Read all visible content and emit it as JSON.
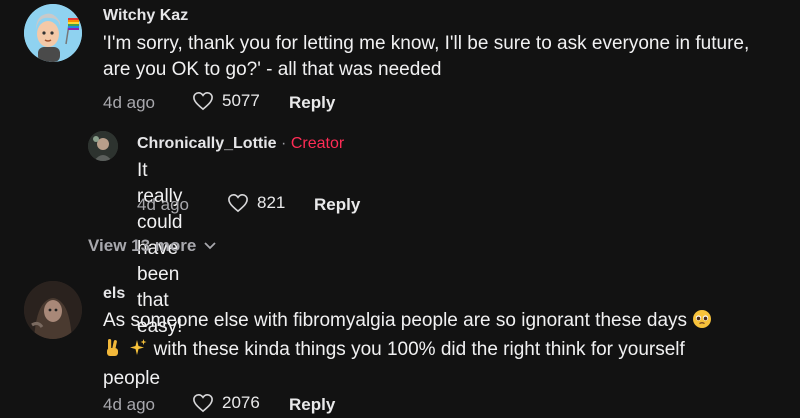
{
  "comments": [
    {
      "username": "Witchy Kaz",
      "text": "'I'm sorry, thank you for letting me know, I'll be sure to ask everyone in future, are you OK to go?' - all that was needed",
      "time": "4d ago",
      "likes": "5077",
      "reply_label": "Reply"
    },
    {
      "username": "Chronically_Lottie",
      "separator": "·",
      "badge": "Creator",
      "text": "It really could have been that easy!",
      "time": "4d ago",
      "likes": "821",
      "reply_label": "Reply"
    },
    {
      "username": "els",
      "text_line1": "As someone else with fibromyalgia people are so ignorant these days",
      "text_line2": "with these kinda things you 100% did the right think for yourself",
      "text_line3": "people",
      "emojis": [
        "pleading-face",
        "victory-hand",
        "sparkles"
      ],
      "time": "4d ago",
      "likes": "2076",
      "reply_label": "Reply"
    }
  ],
  "view_more": "View 13 more",
  "colors": {
    "background": "#121212",
    "creator": "#fe2c55",
    "muted": "#a8a8ad"
  }
}
